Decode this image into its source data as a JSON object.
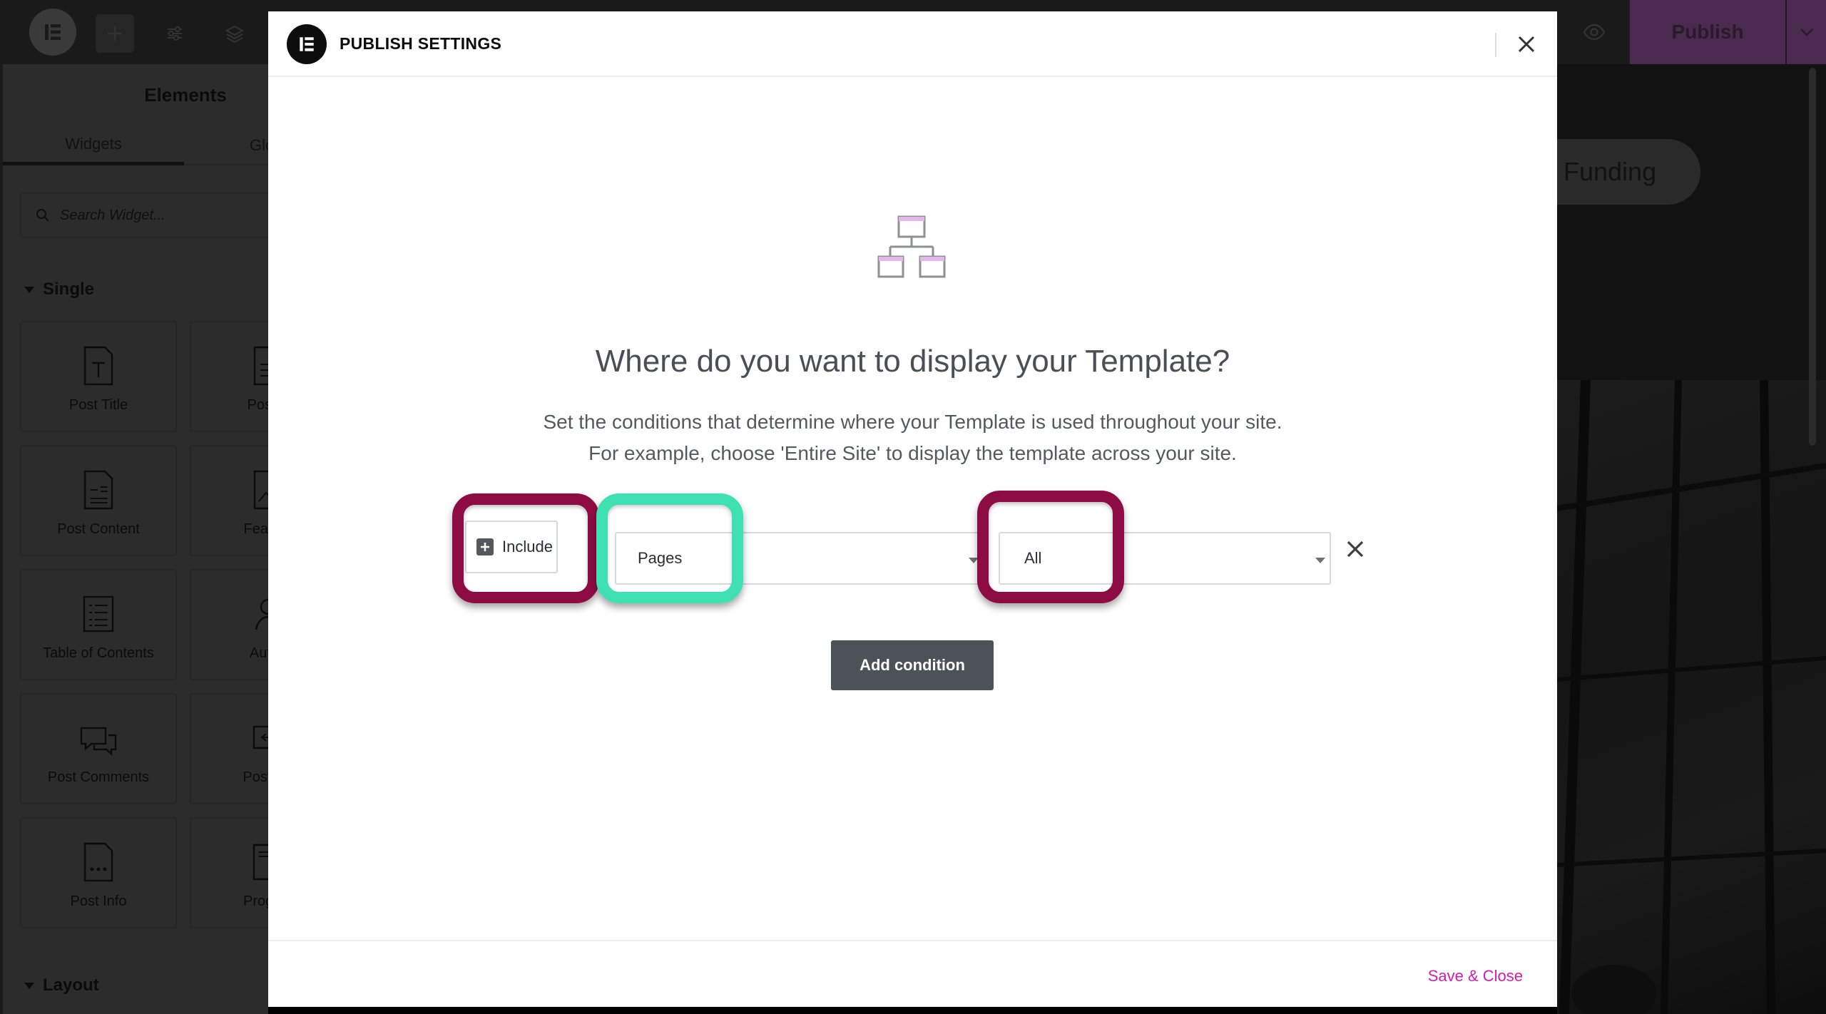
{
  "topbar": {
    "publish_label": "Publish"
  },
  "sidebar": {
    "title": "Elements",
    "tabs": [
      "Widgets",
      "Glo"
    ],
    "search_placeholder": "Search Widget...",
    "section_single": "Single",
    "section_layout": "Layout",
    "widgets": [
      {
        "label": "Post Title",
        "icon": "post-title-icon"
      },
      {
        "label": "Post E",
        "icon": "post-excerpt-icon"
      },
      {
        "label": "Post Content",
        "icon": "post-content-icon"
      },
      {
        "label": "Feature",
        "icon": "featured-image-icon"
      },
      {
        "label": "Table of Contents",
        "icon": "table-of-contents-icon"
      },
      {
        "label": "Autho",
        "icon": "author-box-icon"
      },
      {
        "label": "Post Comments",
        "icon": "post-comments-icon"
      },
      {
        "label": "Post Na",
        "icon": "post-navigation-icon"
      },
      {
        "label": "Post Info",
        "icon": "post-info-icon"
      },
      {
        "label": "Progres",
        "icon": "progress-tracker-icon"
      }
    ]
  },
  "preview": {
    "pill_text": "Funding"
  },
  "modal": {
    "title": "PUBLISH SETTINGS",
    "heading": "Where do you want to display your Template?",
    "description_line1": "Set the conditions that determine where your Template is used throughout your site.",
    "description_line2": "For example, choose 'Entire Site' to display the template across your site.",
    "condition": {
      "include_label": "Include",
      "type_value": "Pages",
      "sub_value": "All"
    },
    "add_condition_label": "Add condition",
    "save_close_label": "Save & Close"
  },
  "colors": {
    "highlight_red": "#8e0c44",
    "highlight_green": "#3fe0b1",
    "save_close": "#d41cb0",
    "add_button": "#4b5359"
  }
}
